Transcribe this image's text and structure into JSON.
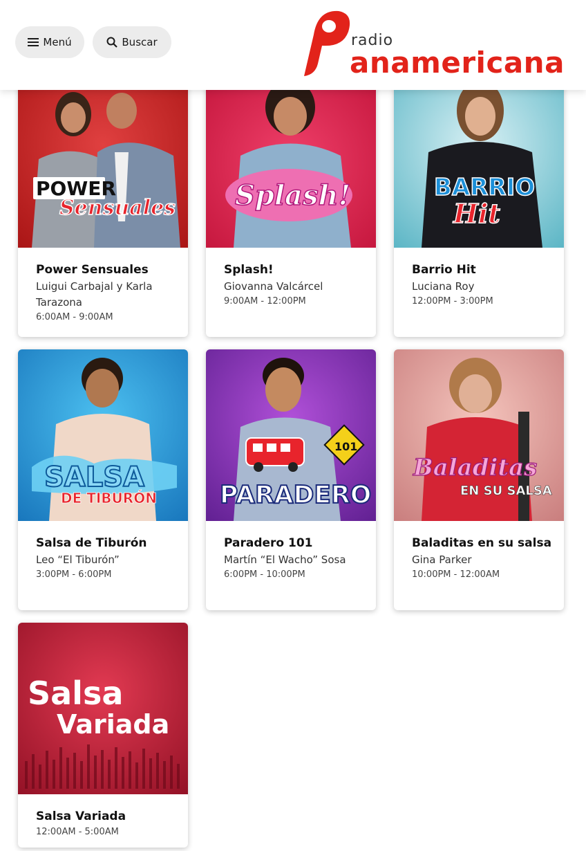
{
  "header": {
    "menu_label": "Menú",
    "search_label": "Buscar",
    "logo_small": "radio",
    "logo_large": "anamericana"
  },
  "colors": {
    "brand_red": "#e2231a"
  },
  "programs": [
    {
      "title": "Power Sensuales",
      "host": "Luigui Carbajal y Karla Tarazona",
      "time": "6:00AM - 9:00AM",
      "art_text": "POWER Sensuales"
    },
    {
      "title": "Splash!",
      "host": "Giovanna Valcárcel",
      "time": "9:00AM - 12:00PM",
      "art_text": "Splash!"
    },
    {
      "title": "Barrio Hit",
      "host": "Luciana Roy",
      "time": "12:00PM - 3:00PM",
      "art_text": "BARRIO Hit"
    },
    {
      "title": "Salsa de Tiburón",
      "host": "Leo “El Tiburón”",
      "time": "3:00PM - 6:00PM",
      "art_text": "SALSA DE TIBURÓN"
    },
    {
      "title": "Paradero 101",
      "host": "Martín “El Wacho” Sosa",
      "time": "6:00PM - 10:00PM",
      "art_text": "PARADERO 101"
    },
    {
      "title": "Baladitas en su salsa",
      "host": "Gina Parker",
      "time": "10:00PM - 12:00AM",
      "art_text": "Baladitas EN SU SALSA"
    },
    {
      "title": "Salsa Variada",
      "host": "",
      "time": "12:00AM - 5:00AM",
      "art_text": "Salsa Variada"
    }
  ]
}
